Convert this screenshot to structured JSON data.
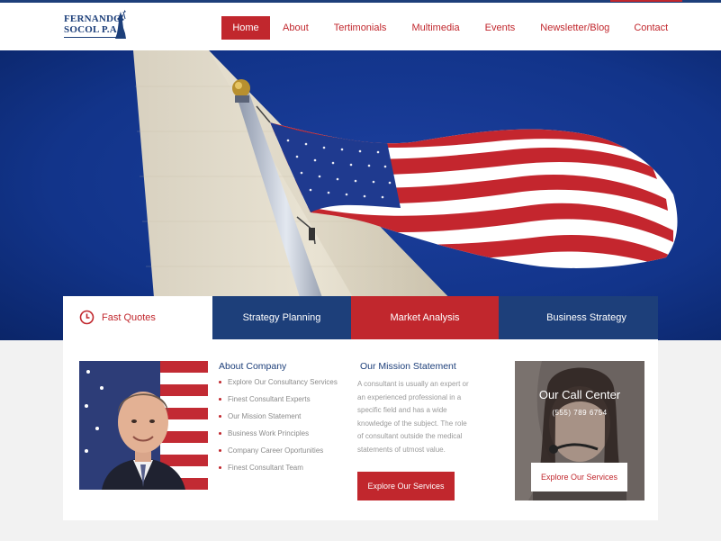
{
  "brand": {
    "line1": "FERNANDO",
    "line2": "SOCOL P.A."
  },
  "nav": {
    "items": [
      "Home",
      "About",
      "Tertimonials",
      "Multimedia",
      "Events",
      "Newsletter/Blog",
      "Contact"
    ],
    "active": "Home"
  },
  "tabs": [
    "Fast Quotes",
    "Strategy Planning",
    "Market Analysis",
    "Business Strategy"
  ],
  "about": {
    "title": "About Company",
    "items": [
      "Explore Our Consultancy Services",
      "Finest Consultant Experts",
      "Our Mission Statement",
      "Business Work Principles",
      "Company Career Oportunities",
      "Finest Consultant Team"
    ]
  },
  "mission": {
    "title": "Our Mission Statement",
    "text": "A consultant is usually an expert or an experienced professional in a specific field and has a wide knowledge of the subject. The role of consultant outside the medical statements of utmost value.",
    "button": "Explore Our Services"
  },
  "call_center": {
    "title": "Our Call Center",
    "phone": "(555) 789 6754",
    "button": "Explore Our Services"
  },
  "colors": {
    "navy": "#1d3f7a",
    "red": "#c1272d",
    "white": "#ffffff"
  },
  "icons": {
    "fast_quotes": "clock-icon"
  }
}
